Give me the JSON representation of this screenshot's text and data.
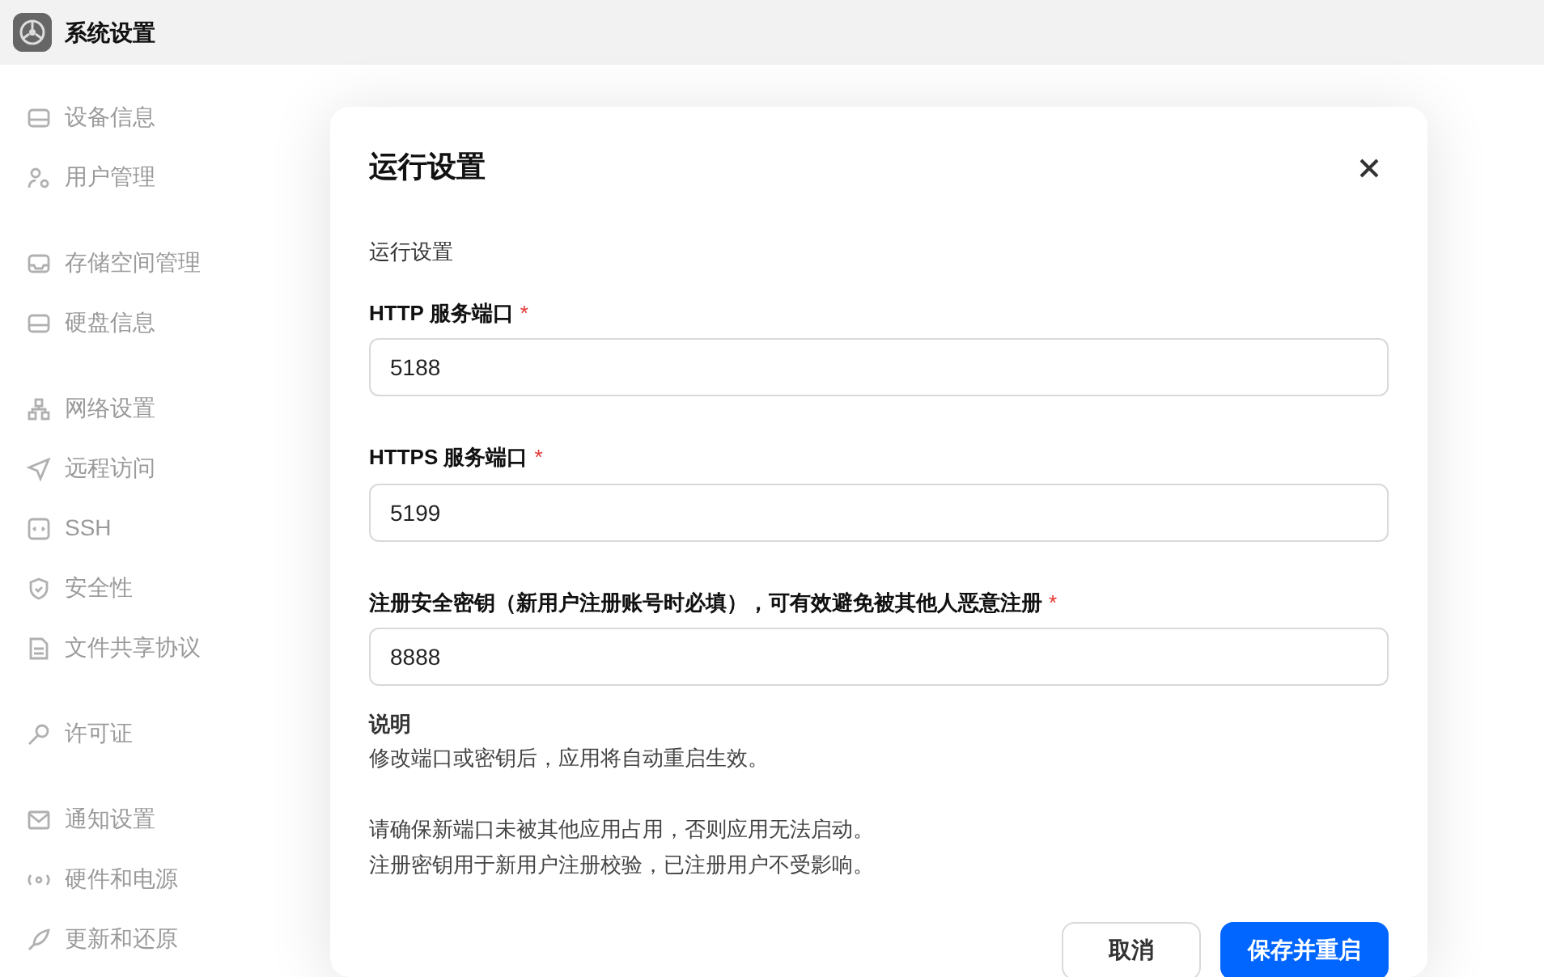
{
  "window": {
    "title": "系统设置"
  },
  "sidebar": {
    "groups": [
      {
        "items": [
          "设备信息",
          "用户管理"
        ]
      },
      {
        "items": [
          "存储空间管理",
          "硬盘信息"
        ]
      },
      {
        "items": [
          "网络设置",
          "远程访问",
          "SSH",
          "安全性",
          "文件共享协议"
        ]
      },
      {
        "items": [
          "许可证"
        ]
      },
      {
        "items": [
          "通知设置",
          "硬件和电源",
          "更新和还原"
        ]
      }
    ]
  },
  "dialog": {
    "title": "运行设置",
    "section": "运行设置",
    "fields": [
      {
        "label": "HTTP 服务端口",
        "required_mark": "*",
        "value": "5188"
      },
      {
        "label": "HTTPS 服务端口",
        "required_mark": "*",
        "value": "5199"
      },
      {
        "label": "注册安全密钥（新用户注册账号时必填），可有效避免被其他人恶意注册",
        "required_mark": "*",
        "value": "8888"
      }
    ],
    "note": {
      "title": "说明",
      "paragraphs": [
        [
          "修改端口或密钥后，应用将自动重启生效。"
        ],
        [
          "请确保新端口未被其他应用占用，否则应用无法启动。",
          "注册密钥用于新用户注册校验，已注册用户不受影响。"
        ]
      ]
    },
    "buttons": [
      {
        "label": "取消",
        "kind": "secondary"
      },
      {
        "label": "保存并重启",
        "kind": "primary"
      }
    ]
  }
}
